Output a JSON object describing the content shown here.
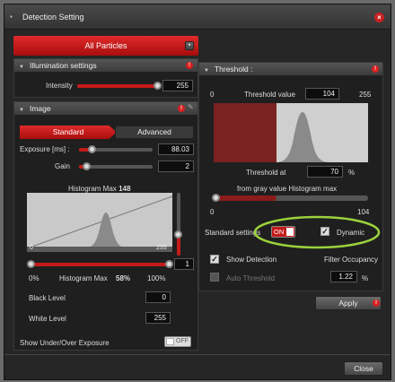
{
  "window": {
    "title": "Detection Setting"
  },
  "particles_button": "All Particles",
  "illumination": {
    "header": "Illumination settings",
    "intensity_label": "Intensity",
    "intensity_value": "255",
    "intensity_level": 1.0
  },
  "image": {
    "header": "Image",
    "tabs": [
      "Standard",
      "Advanced"
    ],
    "active_tab": "Standard",
    "exposure_label": "Exposure [ms] :",
    "exposure_value": "88.03",
    "gain_label": "Gain",
    "gain_value": "2",
    "histogram_max_label": "Histogram Max",
    "histogram_max_value": "148",
    "hist_axis_min": "0",
    "hist_axis_max": "255",
    "vertical_slider_value": "1",
    "pct_min": "0%",
    "pct_label": "Histogram Max",
    "pct_value": "58%",
    "pct_max": "100%",
    "black_level_label": "Black Level",
    "black_level_value": "0",
    "white_level_label": "White Level",
    "white_level_value": "255",
    "show_under_over_label": "Show Under/Over Exposure",
    "show_under_over_state": "OFF"
  },
  "threshold": {
    "header": "Threshold :",
    "axis_min": "0",
    "value_label": "Threshold value",
    "value": "104",
    "axis_max": "255",
    "threshold_at_label": "Threshold at",
    "threshold_at_value": "70",
    "threshold_at_unit": "%",
    "from_gray_label": "from gray value Histogram max",
    "slider_min": "0",
    "slider_max": "104",
    "standard_settings_label": "Standard settings",
    "standard_settings_state": "ON",
    "dynamic_label": "Dynamic",
    "show_detection_label": "Show Detection",
    "filter_occupancy_label": "Filter Occupancy",
    "auto_threshold_label": "Auto Threshold",
    "filter_occupancy_value": "1.22",
    "filter_occupancy_unit": "%"
  },
  "apply_label": "Apply",
  "close_label": "Close",
  "colors": {
    "accent_red": "#c41a1a",
    "highlight_green": "#9bd23c"
  }
}
